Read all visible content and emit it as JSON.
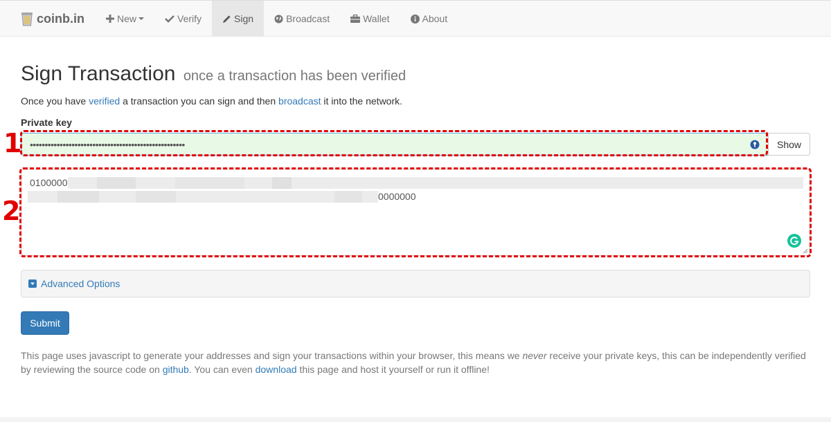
{
  "brand": {
    "name": "coinb.in"
  },
  "nav": {
    "new": "New",
    "verify": "Verify",
    "sign": "Sign",
    "broadcast": "Broadcast",
    "wallet": "Wallet",
    "about": "About",
    "active": "Sign"
  },
  "page": {
    "title": "Sign Transaction",
    "subtitle": "once a transaction has been verified",
    "intro": {
      "part1": "Once you have ",
      "verified_link": "verified",
      "part2": " a transaction you can sign and then ",
      "broadcast_link": "broadcast",
      "part3": " it into the network."
    }
  },
  "private_key": {
    "label": "Private key",
    "masked_value": "••••••••••••••••••••••••••••••••••••••••••••••••••••",
    "show_label": "Show"
  },
  "transaction": {
    "line1_visible": "0100000",
    "line2_visible": "0000000"
  },
  "annotations": {
    "box1": "1",
    "box2": "2",
    "color": "#e00000"
  },
  "advanced": {
    "label": "Advanced Options"
  },
  "submit": {
    "label": "Submit"
  },
  "footer": {
    "part1": "This page uses javascript to generate your addresses and sign your transactions within your browser, this means we ",
    "never": "never",
    "part2": " receive your private keys, this can be independently verified by reviewing the source code on ",
    "github_link": "github",
    "part3": ". You can even ",
    "download_link": "download",
    "part4": " this page and host it yourself or run it offline!"
  },
  "icons": {
    "brand": "bin-icon",
    "new": "plus-icon",
    "verify": "check-icon",
    "sign": "pencil-icon",
    "broadcast": "globe-icon",
    "wallet": "briefcase-icon",
    "about": "info-icon",
    "advanced": "collapse-down-icon",
    "password_manager": "key-icon",
    "grammar": "grammarly-icon"
  },
  "colors": {
    "accent": "#337ab7",
    "key_field_bg": "#e8f9e6",
    "grammarly": "#15c39a"
  }
}
